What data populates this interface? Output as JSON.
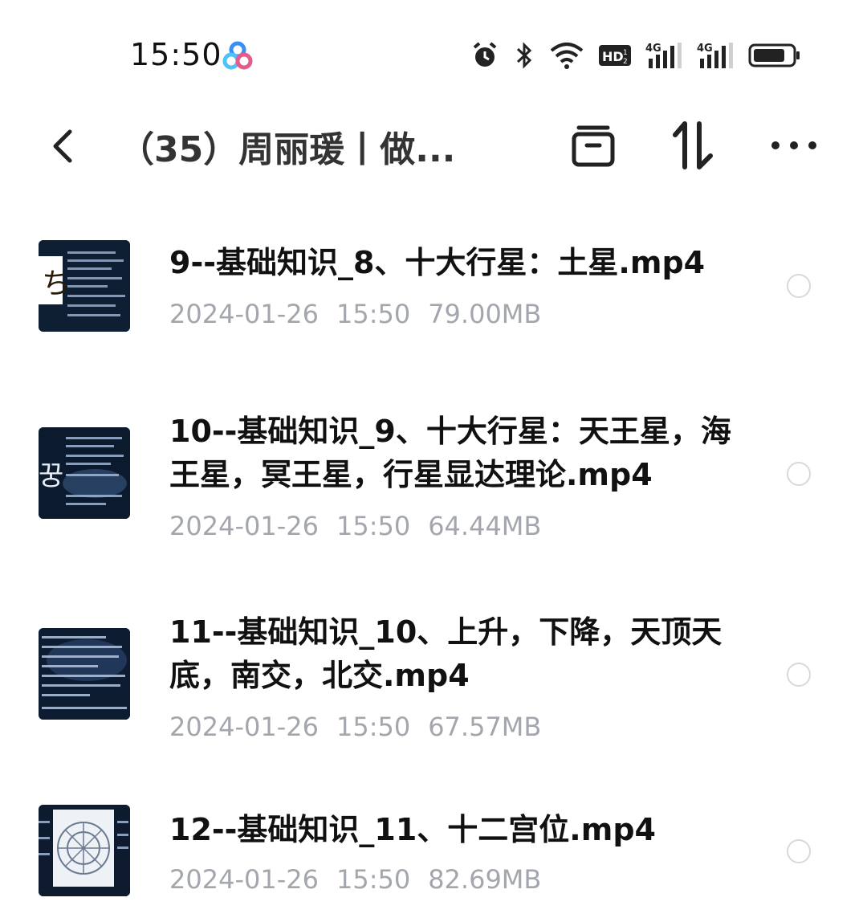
{
  "status_bar": {
    "time": "15:50",
    "icons": [
      "app-logo-icon",
      "alarm-icon",
      "bluetooth-icon",
      "wifi-icon",
      "hd-icon",
      "signal-4g-icon",
      "signal-4g-icon",
      "battery-icon"
    ],
    "hd_label": "HD",
    "net_label_1": "4G",
    "net_label_2": "4G"
  },
  "header": {
    "title": "（35）周丽瑗丨做...",
    "icons": [
      "back-icon",
      "archive-icon",
      "sort-icon",
      "more-icon"
    ]
  },
  "files": [
    {
      "name": "9--基础知识_8、十大行星：土星.mp4",
      "date": "2024-01-26",
      "time": "15:50",
      "size": "79.00MB"
    },
    {
      "name": "10--基础知识_9、十大行星：天王星，海王星，冥王星，行星显达理论.mp4",
      "date": "2024-01-26",
      "time": "15:50",
      "size": "64.44MB"
    },
    {
      "name": "11--基础知识_10、上升，下降，天顶天底，南交，北交.mp4",
      "date": "2024-01-26",
      "time": "15:50",
      "size": "67.57MB"
    },
    {
      "name": "12--基础知识_11、十二宫位.mp4",
      "date": "2024-01-26",
      "time": "15:50",
      "size": "82.69MB"
    }
  ],
  "colors": {
    "meta_text": "#a3a7ad",
    "radio_border": "#d9d9d9",
    "thumb_bg": "#0b1726"
  }
}
